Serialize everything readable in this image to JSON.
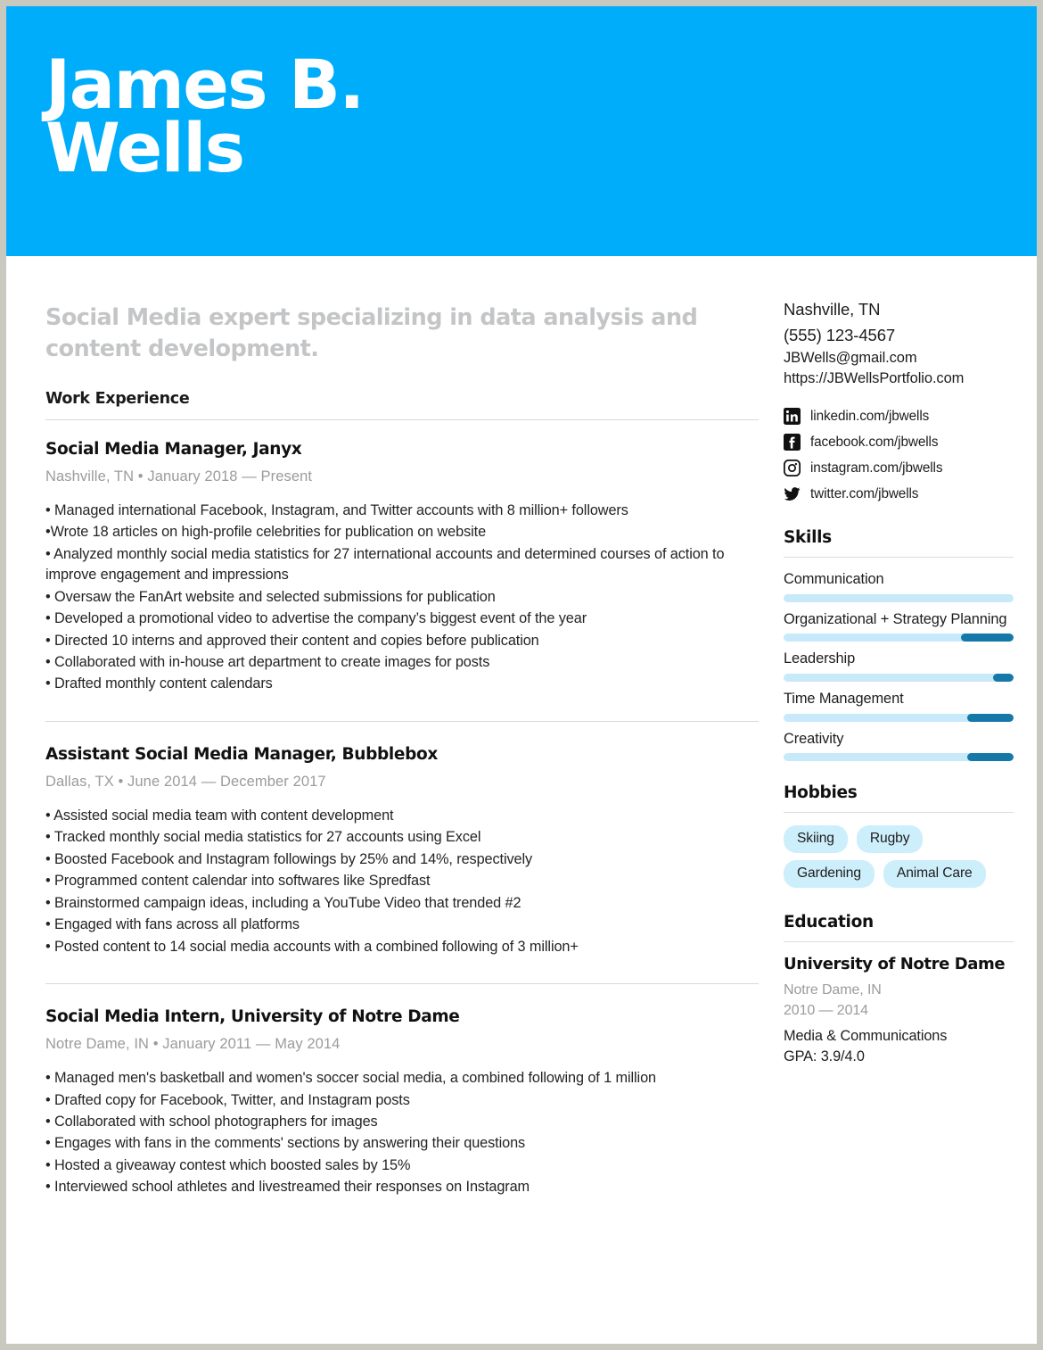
{
  "header": {
    "name_line1": "James B.",
    "name_line2": "Wells",
    "banner_color": "#00adfb"
  },
  "summary": "Social Media expert specializing in data analysis and content development.",
  "work": {
    "section_title": "Work Experience",
    "jobs": [
      {
        "title": "Social Media Manager, Janyx",
        "meta": "Nashville, TN • January 2018 — Present",
        "bullets": [
          "• Managed international Facebook, Instagram, and Twitter accounts with 8 million+ followers",
          "•Wrote 18 articles on high-profile celebrities for publication on website",
          "• Analyzed monthly social media statistics for 27 international accounts and determined courses of action to improve engagement and impressions",
          "• Oversaw the FanArt website and selected submissions for publication",
          "• Developed a promotional video to advertise the company’s biggest event of the year",
          "• Directed 10 interns and approved their content and copies before publication",
          "• Collaborated with in-house art department to create images for posts",
          "• Drafted monthly content calendars"
        ]
      },
      {
        "title": "Assistant Social Media Manager, Bubblebox",
        "meta": "Dallas, TX • June 2014 — December 2017",
        "bullets": [
          "• Assisted social media team with content development",
          "• Tracked monthly social media statistics for 27 accounts using Excel",
          "• Boosted Facebook and Instagram followings by 25% and 14%, respectively",
          "• Programmed content calendar into softwares like Spredfast",
          "• Brainstormed campaign ideas, including a YouTube Video that trended #2",
          "• Engaged with fans across all platforms",
          "• Posted content to 14 social media accounts with a combined following of 3 million+"
        ]
      },
      {
        "title": "Social Media Intern, University of Notre Dame",
        "meta": "Notre Dame, IN • January 2011 — May 2014",
        "bullets": [
          "• Managed men's basketball and women's soccer social media, a combined following of 1 million",
          "• Drafted copy for Facebook, Twitter, and Instagram posts",
          "• Collaborated with school photographers for images",
          "• Engages with fans in the comments' sections by answering their questions",
          "• Hosted a giveaway contest which boosted sales by 15%",
          "• Interviewed school athletes and livestreamed their responses on Instagram"
        ]
      }
    ]
  },
  "contact": {
    "location": "Nashville, TN",
    "phone": "(555) 123-4567",
    "email": "JBWells@gmail.com",
    "website": "https://JBWellsPortfolio.com",
    "social": [
      {
        "icon": "linkedin-icon",
        "label": "linkedin.com/jbwells"
      },
      {
        "icon": "facebook-icon",
        "label": "facebook.com/jbwells"
      },
      {
        "icon": "instagram-icon",
        "label": "instagram.com/jbwells"
      },
      {
        "icon": "twitter-icon",
        "label": "twitter.com/jbwells"
      }
    ]
  },
  "skills": {
    "section_title": "Skills",
    "track_color": "#c7e9fa",
    "fill_color": "#1478a8",
    "items": [
      {
        "name": "Communication",
        "fill_percent": 0
      },
      {
        "name": "Organizational + Strategy Planning",
        "fill_percent": 23
      },
      {
        "name": "Leadership",
        "fill_percent": 9
      },
      {
        "name": "Time Management",
        "fill_percent": 20
      },
      {
        "name": "Creativity",
        "fill_percent": 20
      }
    ]
  },
  "hobbies": {
    "section_title": "Hobbies",
    "tag_color": "#cdeefb",
    "items": [
      "Skiing",
      "Rugby",
      "Gardening",
      "Animal Care"
    ]
  },
  "education": {
    "section_title": "Education",
    "school": "University of Notre Dame",
    "location": "Notre Dame, IN",
    "years": "2010 — 2014",
    "major": "Media & Communications",
    "gpa": "GPA: 3.9/4.0"
  }
}
